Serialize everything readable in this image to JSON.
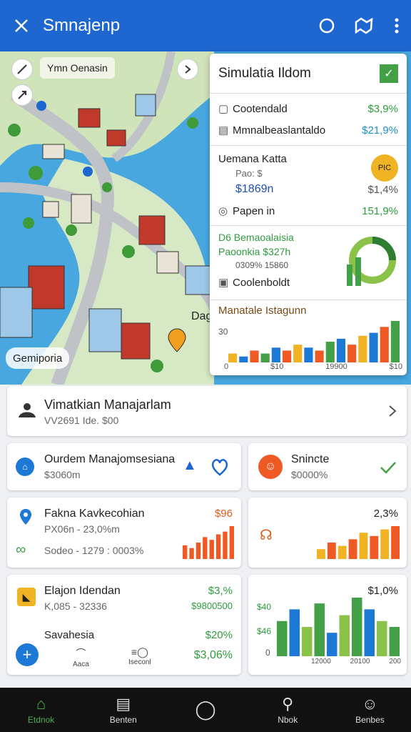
{
  "appbar": {
    "title": "Smnajenp"
  },
  "map": {
    "chip": "Ymn Oenasin",
    "badge": "Gemiporia",
    "label": "Dag"
  },
  "panel": {
    "title": "Simulatia Ildom",
    "rows1": [
      {
        "label": "Cootendald",
        "value": "$3,9%"
      },
      {
        "label": "Mmnalbeaslantaldo",
        "value": "$21,9%"
      }
    ],
    "sec2": {
      "title": "Uemana Katta",
      "sub": "Pao: $",
      "amount": "$1869n",
      "pct": "$1,4%",
      "row_label": "Papen in",
      "row_value": "151,9%",
      "badge": "PIC"
    },
    "sec3": {
      "line1": "D6 Bemaoalaisia",
      "line2": "Paoonkia $327h",
      "line3": "0309% 15860",
      "line4": "Coolenboldt"
    },
    "chart_title": "Manatale Istagunn",
    "chart_ylabel": "30",
    "chart_x": [
      "0",
      "$10",
      "19900",
      "$10"
    ]
  },
  "card_main": {
    "title": "Vimatkian Manajarlam",
    "sub": "VV2691 Ide. $00"
  },
  "card_a": {
    "title": "Ourdem Manajomsesiana",
    "sub": "$3060m"
  },
  "card_b": {
    "title": "Snincte",
    "sub": "$0000%"
  },
  "card_c": {
    "title": "Fakna Kavkecohian",
    "line1": "PX06n - 23,0%m",
    "line2": "Sodeo - 1279 : 0003%",
    "pct": "$96"
  },
  "card_d": {
    "pct": "2,3%"
  },
  "card_e": {
    "title": "Elajon Idendan",
    "sub": "K,085 - 32336",
    "val1": "$3,%",
    "val2": "$9800500",
    "line2": "Savahesia",
    "val3": "$20%",
    "val4": "$3,06%",
    "b1": "Aaca",
    "b2": "Iseconl"
  },
  "card_f": {
    "top": "$1,0%",
    "y1": "$40",
    "y2": "$46",
    "y3": "0",
    "x": [
      "12000",
      "20100",
      "200"
    ]
  },
  "chart_data": [
    {
      "type": "bar",
      "title": "Manatale Istagunn",
      "series": [
        {
          "values": [
            3,
            2,
            4,
            3,
            5,
            4,
            6,
            5,
            4,
            7,
            8,
            6,
            9,
            10,
            12,
            14
          ]
        }
      ]
    },
    {
      "type": "bar",
      "series": [
        {
          "values": [
            5,
            4,
            6,
            8,
            7,
            9,
            10,
            12
          ]
        }
      ]
    },
    {
      "type": "bar",
      "series": [
        {
          "values": [
            3,
            5,
            4,
            6,
            8,
            7,
            9,
            10
          ]
        }
      ]
    },
    {
      "type": "bar",
      "series": [
        {
          "values": [
            6,
            8,
            5,
            9,
            4,
            7,
            10,
            8,
            6,
            5
          ]
        }
      ]
    }
  ],
  "bottom_nav": [
    {
      "label": "Etdnok",
      "icon": "home-icon"
    },
    {
      "label": "Benten",
      "icon": "list-icon"
    },
    {
      "label": "",
      "icon": "compass-icon"
    },
    {
      "label": "Nbok",
      "icon": "search-icon"
    },
    {
      "label": "Benbes",
      "icon": "profile-icon"
    }
  ]
}
